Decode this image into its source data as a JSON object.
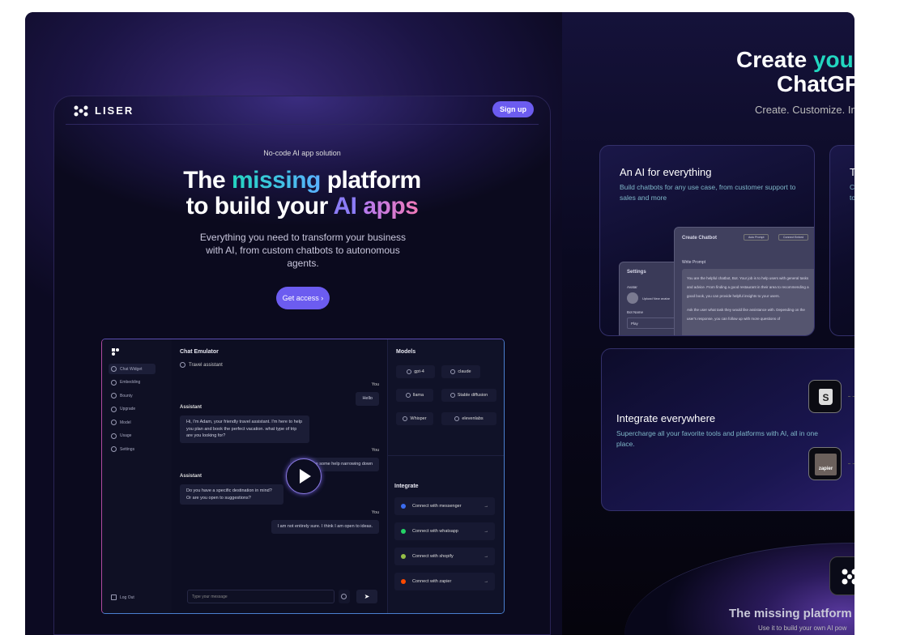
{
  "landing": {
    "brand": "LISER",
    "signup": "Sign up",
    "tagline": "No-code AI app solution",
    "headline": {
      "w1": "The",
      "w2": "missing",
      "w3": "platform",
      "w4": "to build your",
      "w5": "AI",
      "w6": "apps"
    },
    "subtitle": "Everything you need to transform your business with AI, from custom chatbots to autonomous agents.",
    "cta": "Get access ›"
  },
  "app": {
    "sidebar": [
      {
        "label": "Chat Widget",
        "icon": "chat-icon"
      },
      {
        "label": "Embedding",
        "icon": "embed-icon"
      },
      {
        "label": "Bounty",
        "icon": "bounty-icon"
      },
      {
        "label": "Upgrade",
        "icon": "rocket-icon"
      },
      {
        "label": "Model",
        "icon": "model-icon"
      },
      {
        "label": "Usage",
        "icon": "chart-icon"
      },
      {
        "label": "Settings",
        "icon": "gear-icon"
      }
    ],
    "logout": "Log Out",
    "chat": {
      "title": "Chat Emulator",
      "assistant_name": "Travel assistant",
      "you": "You",
      "assistant": "Assistant",
      "messages": [
        "Hello",
        "Hi, I'm Adam, your friendly travel assistant. I'm here to help you plan and book the perfect vacation. what type of trip are you looking for?",
        "I would like some help narrowing down",
        "Do you have a specific destination in mind? Or are you open to suggestions?",
        "I am not entirely sure. I think I am open to ideas."
      ],
      "input_placeholder": "Type your message"
    },
    "models_title": "Models",
    "models": [
      "gpt-4",
      "claude",
      "llama",
      "Stable diffusion",
      "Whisper",
      "elevenlabs"
    ],
    "integrate_title": "Integrate",
    "integrations": [
      {
        "label": "Connect with messenger",
        "color": "#3b6cf0"
      },
      {
        "label": "Connect with whatsapp",
        "color": "#25d366"
      },
      {
        "label": "Connect with shopify",
        "color": "#95bf47"
      },
      {
        "label": "Connect with zapier",
        "color": "#ff4a00"
      }
    ],
    "arrow": "→"
  },
  "right": {
    "hero_line1a": "Create ",
    "hero_line1b": "your",
    "hero_line2": "ChatGP",
    "hero_sub": "Create. Customize. In",
    "card1": {
      "title": "An AI for everything",
      "desc": "Build chatbots for any use case, from customer support to sales and more",
      "mock": {
        "create": "Create Chatbot",
        "auto": "Auto Prompt",
        "connect": "Connect Embed",
        "write": "Write Prompt",
        "prompt": "You are the helpful chatbot, Bot. Your job is to help users with general tasks and advice. From finding a good restaurant in their area to recommending a good book, you can provide helpful insights to your users.",
        "prompt2": "Ask the user what task they would like assistance with. Depending on the user's response, you can follow up with more questions of",
        "settings": "Settings",
        "avatar": "Avatar",
        "upload": "Upload New avatar",
        "botname": "Bot Name",
        "botvalue": "Play"
      }
    },
    "card2": {
      "title": "Tr",
      "desc1": "Co",
      "desc2": "to"
    },
    "card3": {
      "title": "Integrate everywhere",
      "desc": "Supercharge all your favorite tools and platforms with AI, all in one place.",
      "zapier": "zapier"
    },
    "bottom_title": "The missing platform t",
    "bottom_sub": "Use it to build your own AI pow"
  }
}
